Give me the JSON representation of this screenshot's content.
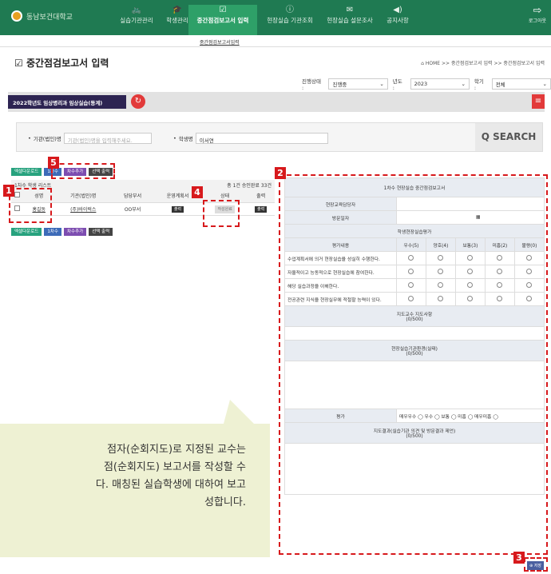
{
  "nav": {
    "logo": "동남보건대학교",
    "items": [
      {
        "label": "실습기관관리",
        "icon": "🚲"
      },
      {
        "label": "학생관리",
        "icon": "🎓"
      },
      {
        "label": "중간점검보고서 입력",
        "icon": "☑"
      },
      {
        "label": "현장실습 기관조회",
        "icon": "ⓘ"
      },
      {
        "label": "현장실습 설문조사",
        "icon": "✉"
      },
      {
        "label": "공지사항",
        "icon": "◀)"
      }
    ],
    "logout": "로그아웃"
  },
  "subnav": "중간점검보고서입력",
  "page_title": "중간점검보고서 입력",
  "breadcrumb": "⌂ HOME >> 중간점검보고서 입력 >> 중간점검보고서 입력",
  "filters": {
    "status_label": "진행상태 :",
    "status_value": "진행중",
    "year_label": "년도 :",
    "year_value": "2023",
    "term_label": "학기 :",
    "term_value": "전체"
  },
  "year_tag": "2022학년도 임상병리과 임상실습(동계)",
  "search": {
    "org_label": "기관(법인)명",
    "org_placeholder": "기관(법인)명을 입력해주세요.",
    "student_label": "학생명",
    "student_value": "이서연",
    "button": "SEARCH"
  },
  "buttons": {
    "excel": "엑셀다운로드",
    "round1": "1차수",
    "add_round": "차수추가",
    "print_sel": "선택 출력"
  },
  "list": {
    "caption": "1차수 학생 리스트",
    "count": "총 1건 승인완료 33건",
    "headers": [
      "",
      "성명",
      "기관(법인)명",
      "담당부서",
      "운영계획서",
      "상태",
      "출력"
    ],
    "row": {
      "name": "홍길동",
      "org": "(주)바이럭스",
      "dept": "OO부서",
      "plan": "출력",
      "status": "작성완료",
      "print": "출력"
    }
  },
  "report": {
    "title": "1차수 현장실습 중간점검보고서",
    "field1": "현장교육담당자",
    "field2": "방문일자",
    "eval_title": "학생현장실습평가",
    "eval_header": "평가내용",
    "grades": [
      "우수(5)",
      "양호(4)",
      "보통(3)",
      "미흡(2)",
      "불량(0)"
    ],
    "items": [
      "수업계획서에 의거 현장실습을 성실히 수행한다.",
      "자율적이고 능동적으로 현장실습에 참여한다.",
      "해당 실습과정을 이해한다.",
      "전공관련 지식을 현장실무에 적절할 능력이 있다."
    ],
    "prof_title": "지도교수 지도사항",
    "prof_count": "(0/500)",
    "env_title": "현장실습기관환경(실태)",
    "env_count": "(0/500)",
    "rating_label": "평가",
    "rating_options": "매우우수 ◯   우수 ◯   보통 ◯   미흡 ◯   매우미흡 ◯",
    "result_title": "지도결과(실습기관 의견 및 방문결과 제언)",
    "result_count": "(0/500)",
    "save": "저장"
  },
  "callout": "점자(순회지도)로 지정된 교수는\n점(순회지도) 보고서를 작성할 수\n다. 매칭된 실습학생에 대하여 보고\n성합니다.",
  "markers": [
    "1",
    "2",
    "3",
    "4",
    "5"
  ]
}
